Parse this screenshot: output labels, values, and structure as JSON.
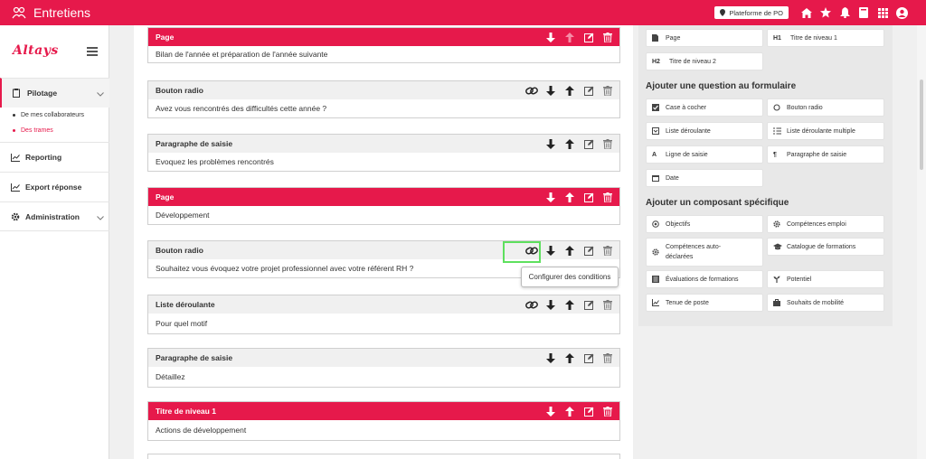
{
  "app": {
    "title": "Entretiens",
    "platform_label": "Plateforme de PO"
  },
  "sidebar": {
    "logo": "Altays",
    "items": [
      {
        "label": "Pilotage",
        "subitems": [
          "De mes collaborateurs",
          "Des trames"
        ]
      },
      {
        "label": "Reporting"
      },
      {
        "label": "Export réponse"
      },
      {
        "label": "Administration"
      }
    ]
  },
  "blocks": [
    {
      "type": "Page",
      "text": "Bilan de l'année et préparation de l'année suivante"
    },
    {
      "type": "Bouton radio",
      "text": "Avez vous rencontrés des difficultés cette année ?"
    },
    {
      "type": "Paragraphe de saisie",
      "text": "Evoquez les problèmes rencontrés"
    },
    {
      "type": "Page",
      "text": "Développement"
    },
    {
      "type": "Bouton radio",
      "text": "Souhaitez vous évoquez votre projet professionnel avec votre référent RH ?"
    },
    {
      "type": "Liste déroulante",
      "text": "Pour quel motif"
    },
    {
      "type": "Paragraphe de saisie",
      "text": "Détaillez"
    },
    {
      "type": "Titre de niveau 1",
      "text": "Actions de développement"
    }
  ],
  "tooltip": "Configurer des conditions",
  "right_panel": {
    "layout_items": [
      {
        "icon": "page-icon",
        "label": "Page"
      },
      {
        "icon": "H1",
        "label": "Titre de niveau 1"
      },
      {
        "icon": "H2",
        "label": "Titre de niveau 2"
      }
    ],
    "question_title": "Ajouter une question au formulaire",
    "question_items": [
      {
        "icon": "checkbox-icon",
        "label": "Case à cocher"
      },
      {
        "icon": "radio-icon",
        "label": "Bouton radio"
      },
      {
        "icon": "dropdown-icon",
        "label": "Liste déroulante"
      },
      {
        "icon": "multi-list-icon",
        "label": "Liste déroulante multiple"
      },
      {
        "icon": "A",
        "label": "Ligne de saisie"
      },
      {
        "icon": "paragraph-icon",
        "label": "Paragraphe de saisie"
      },
      {
        "icon": "calendar-icon",
        "label": "Date"
      }
    ],
    "component_title": "Ajouter un composant spécifique",
    "component_items": [
      {
        "icon": "target-icon",
        "label": "Objectifs"
      },
      {
        "icon": "gear-icon",
        "label": "Compétences emploi"
      },
      {
        "icon": "gear-icon",
        "label": "Compétences auto-déclarées"
      },
      {
        "icon": "graduation-icon",
        "label": "Catalogue de formations"
      },
      {
        "icon": "list-icon",
        "label": "Évaluations de formations"
      },
      {
        "icon": "sprout-icon",
        "label": "Potentiel"
      },
      {
        "icon": "chart-icon",
        "label": "Tenue de poste"
      },
      {
        "icon": "briefcase-icon",
        "label": "Souhaits de mobilité"
      }
    ]
  },
  "colors": {
    "accent": "#e6194b",
    "highlight": "#5ee05e"
  }
}
